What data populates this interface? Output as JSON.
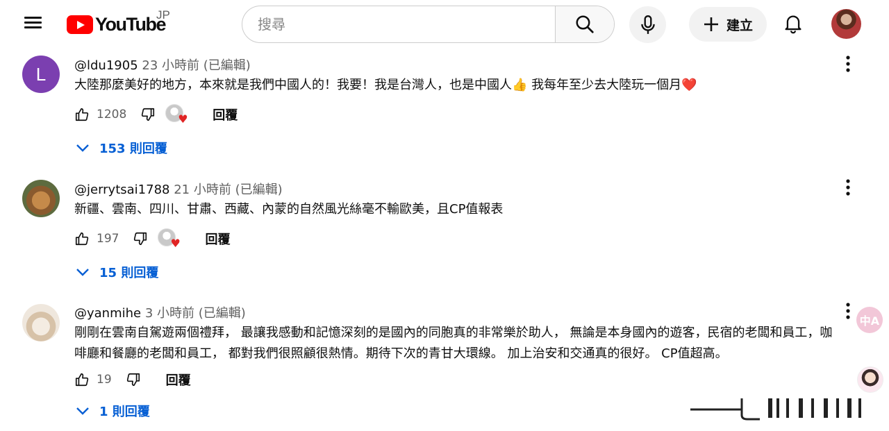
{
  "header": {
    "logo_text": "YouTube",
    "logo_country": "JP",
    "search_placeholder": "搜尋",
    "create_label": "建立"
  },
  "comments": [
    {
      "avatar_letter": "L",
      "author": "@ldu1905",
      "meta": "23 小時前 (已編輯)",
      "text_main": "大陸那麼美好的地方，本來就是我們中國人的！我要！我是台灣人，也是中國人",
      "text_emoji1": "👍",
      "text_tail": " 我每年至少去大陸玩一個月",
      "text_emoji2": "❤️",
      "likes": "1208",
      "reply_label": "回覆",
      "replies_label": "153 則回覆"
    },
    {
      "author": "@jerrytsai1788",
      "meta": "21 小時前 (已編輯)",
      "text": "新疆、雲南、四川、甘肅、西藏、內蒙的自然風光絲毫不輸歐美，且CP值報表",
      "likes": "197",
      "reply_label": "回覆",
      "replies_label": "15 則回覆"
    },
    {
      "author": "@yanmihe",
      "meta": "3 小時前 (已編輯)",
      "text_line1": "剛剛在雲南自駕遊兩個禮拜， 最讓我感動和記憶深刻的是國內的同胞真的非常樂於助人， 無論是本身國內的遊客，民宿的老闆和員工，咖",
      "text_line2": "啡廳和餐廳的老闆和員工， 都對我們很照顧很熱情。期待下次的青甘大環線。 加上治安和交通真的很好。 CP值超高。",
      "likes": "19",
      "reply_label": "回覆",
      "replies_label": "1 則回覆"
    }
  ],
  "overlay": {
    "translate_label": "中A"
  },
  "colors": {
    "brand_red": "#ff0000",
    "link_blue": "#065fd4",
    "avatar_purple": "#7b3fb0"
  }
}
